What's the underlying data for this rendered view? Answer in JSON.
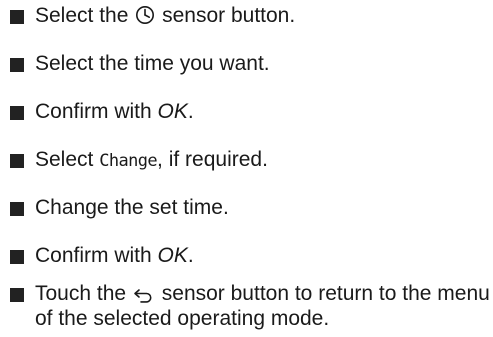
{
  "steps": [
    {
      "pre": "Select the",
      "icon": "clock-icon",
      "post": "sensor button."
    },
    {
      "text": "Select the time you want."
    },
    {
      "pre": "Confirm with",
      "emph": "OK",
      "post": "."
    },
    {
      "pre": "Select",
      "ui": "Change",
      "post": ", if required."
    },
    {
      "text": "Change the set time."
    },
    {
      "pre": "Confirm with",
      "emph": "OK",
      "post": "."
    },
    {
      "pre": "Touch the",
      "icon": "back-arrow-icon",
      "post": "sensor button to return to the menu of the selected operating mode."
    }
  ]
}
